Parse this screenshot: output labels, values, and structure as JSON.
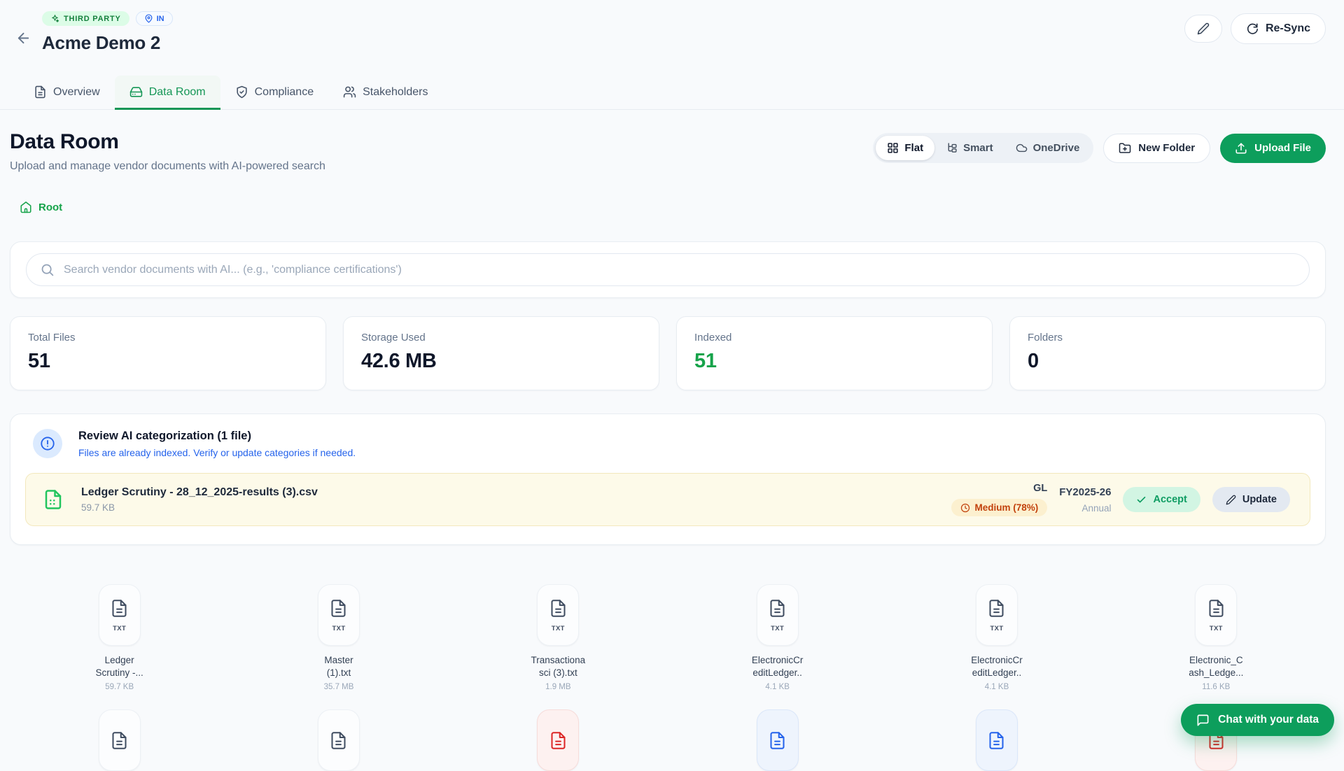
{
  "colors": {
    "accent_green": "#0d9e5c",
    "link_green": "#16a34a",
    "alert_blue": "#2563eb",
    "warn_orange": "#c2410c"
  },
  "header": {
    "badge_third_party": "THIRD PARTY",
    "badge_country": "IN",
    "title": "Acme Demo 2",
    "resync_label": "Re-Sync"
  },
  "tabs": [
    {
      "label": "Overview"
    },
    {
      "label": "Data Room"
    },
    {
      "label": "Compliance"
    },
    {
      "label": "Stakeholders"
    }
  ],
  "page": {
    "title": "Data Room",
    "subtitle": "Upload and manage vendor documents with AI-powered search",
    "breadcrumb": "Root"
  },
  "toolbar": {
    "views": [
      {
        "label": "Flat"
      },
      {
        "label": "Smart"
      },
      {
        "label": "OneDrive"
      }
    ],
    "new_folder": "New Folder",
    "upload": "Upload File"
  },
  "search": {
    "placeholder": "Search vendor documents with AI... (e.g., 'compliance certifications')"
  },
  "stats": [
    {
      "label": "Total Files",
      "value": "51",
      "color": "dark"
    },
    {
      "label": "Storage Used",
      "value": "42.6 MB",
      "color": "dark"
    },
    {
      "label": "Indexed",
      "value": "51",
      "color": "green"
    },
    {
      "label": "Folders",
      "value": "0",
      "color": "dark"
    }
  ],
  "review": {
    "title": "Review AI categorization (1 file)",
    "subtitle": "Files are already indexed. Verify or update categories if needed.",
    "file": {
      "name": "Ledger Scrutiny - 28_12_2025-results (3).csv",
      "size": "59.7 KB",
      "category": "GL",
      "confidence": "Medium (78%)",
      "period": "FY2025-26",
      "frequency": "Annual",
      "accept": "Accept",
      "update": "Update"
    }
  },
  "files": [
    {
      "line1": "Ledger",
      "line2": "Scrutiny -...",
      "size": "59.7 KB",
      "ext": "TXT"
    },
    {
      "line1": "Master",
      "line2": "(1).txt",
      "size": "35.7 MB",
      "ext": "TXT"
    },
    {
      "line1": "Transactiona",
      "line2": "sci (3).txt",
      "size": "1.9 MB",
      "ext": "TXT"
    },
    {
      "line1": "ElectronicCr",
      "line2": "editLedger..",
      "size": "4.1 KB",
      "ext": "TXT"
    },
    {
      "line1": "ElectronicCr",
      "line2": "editLedger..",
      "size": "4.1 KB",
      "ext": "TXT"
    },
    {
      "line1": "Electronic_C",
      "line2": "ash_Ledge...",
      "size": "11.6 KB",
      "ext": "TXT"
    }
  ],
  "partial_files": [
    {
      "color": "slate"
    },
    {
      "color": "slate"
    },
    {
      "color": "red"
    },
    {
      "color": "blue"
    },
    {
      "color": "blue"
    },
    {
      "color": "red"
    }
  ],
  "chat": {
    "label": "Chat with your data"
  }
}
